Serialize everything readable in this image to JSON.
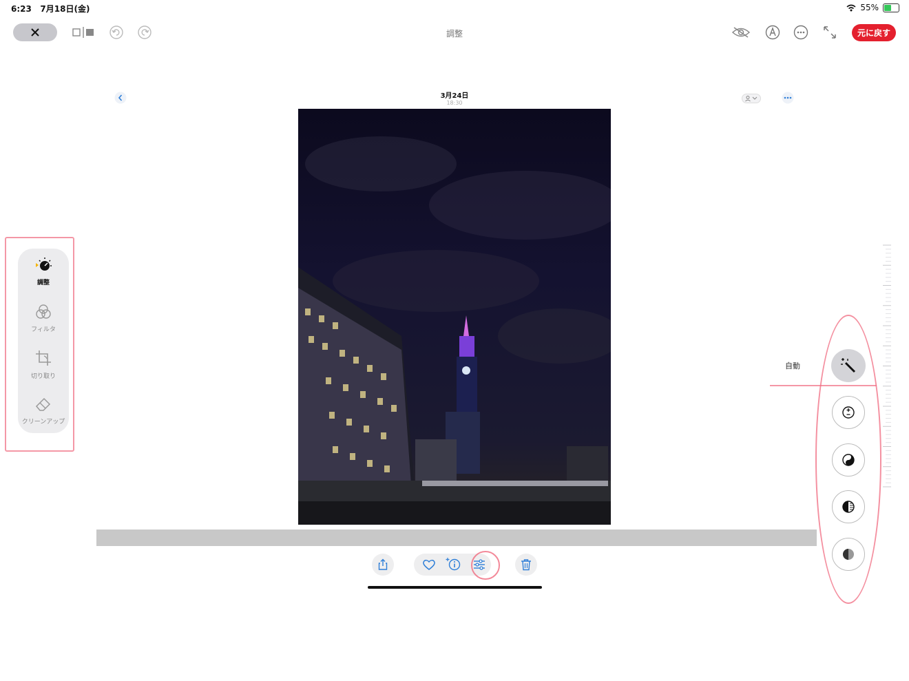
{
  "status": {
    "time": "6:23",
    "date": "7月18日(金)",
    "battery": "55%",
    "battery_level": 0.55
  },
  "toolbar": {
    "title": "調整",
    "revert_label": "元に戻す"
  },
  "photo": {
    "date": "3月24日",
    "time": "18:30"
  },
  "tools": [
    {
      "label": "調整",
      "icon": "adjust-dial-icon",
      "active": true
    },
    {
      "label": "フィルタ",
      "icon": "filters-icon",
      "active": false
    },
    {
      "label": "切り取り",
      "icon": "crop-icon",
      "active": false
    },
    {
      "label": "クリーンアップ",
      "icon": "eraser-icon",
      "active": false
    }
  ],
  "adjustments": {
    "auto_label": "自動"
  },
  "colors": {
    "accent": "#2f7fd8",
    "revert": "#e4202e",
    "annotation": "#f06b80"
  }
}
